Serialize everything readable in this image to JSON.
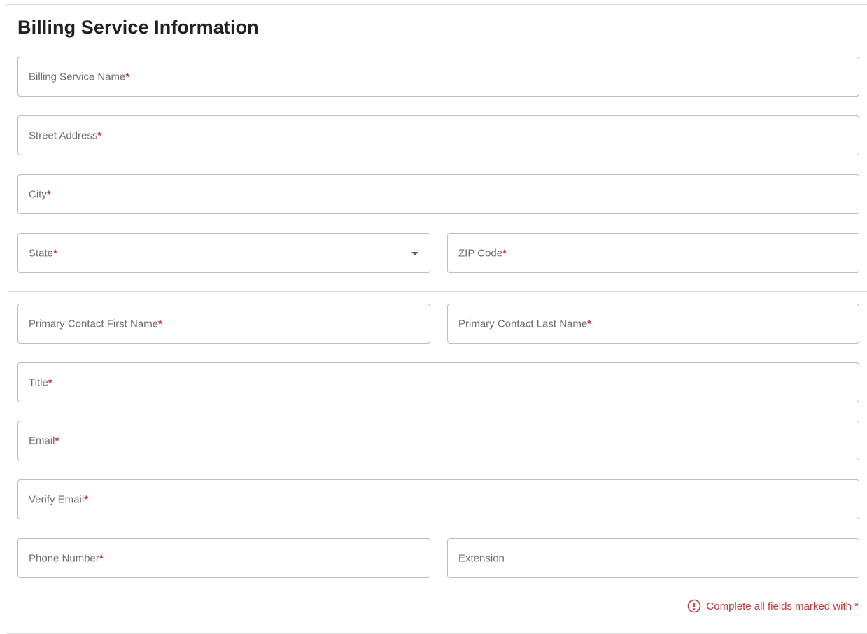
{
  "section": {
    "title": "Billing Service Information"
  },
  "fields": {
    "billing_service_name": {
      "label": "Billing Service Name",
      "required_mark": "*"
    },
    "street_address": {
      "label": "Street Address",
      "required_mark": "*"
    },
    "city": {
      "label": "City",
      "required_mark": "*"
    },
    "state": {
      "label": "State",
      "required_mark": "*"
    },
    "zip_code": {
      "label": "ZIP Code",
      "required_mark": "*"
    },
    "primary_first_name": {
      "label": "Primary Contact First Name",
      "required_mark": "*"
    },
    "primary_last_name": {
      "label": "Primary Contact Last Name",
      "required_mark": "*"
    },
    "title": {
      "label": "Title",
      "required_mark": "*"
    },
    "email": {
      "label": "Email",
      "required_mark": "*"
    },
    "verify_email": {
      "label": "Verify Email",
      "required_mark": "*"
    },
    "phone_number": {
      "label": "Phone Number",
      "required_mark": "*"
    },
    "extension": {
      "label": "Extension"
    }
  },
  "footer": {
    "required_hint": "Complete all fields marked with *"
  },
  "colors": {
    "required": "#d32f2f",
    "border": "#bdbdbd",
    "label": "#6e6e6e"
  },
  "icons": {
    "state_dropdown": "caret-down-icon",
    "hint": "alert-circle-icon"
  }
}
